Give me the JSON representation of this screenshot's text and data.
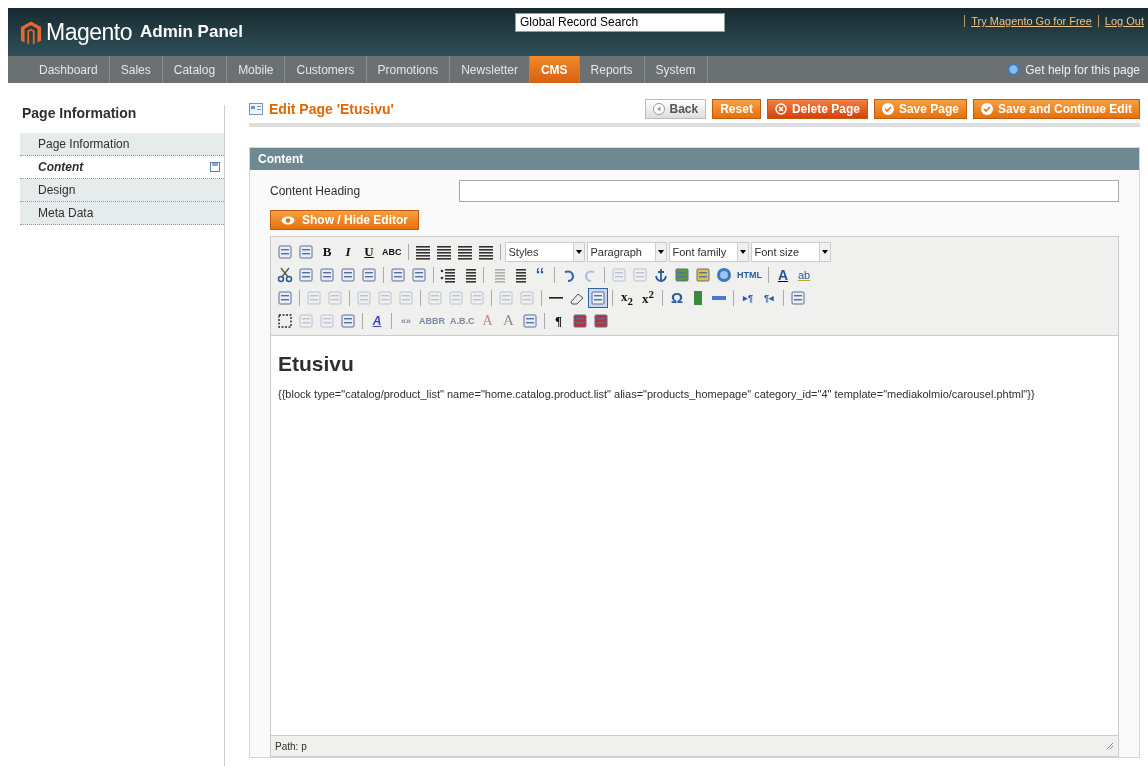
{
  "header": {
    "logo": "Magento",
    "logo_suffix": "Admin Panel",
    "search": {
      "value": "Global Record Search"
    },
    "links": [
      "Try Magento Go for Free",
      "Log Out"
    ]
  },
  "nav": {
    "items": [
      {
        "label": "Dashboard",
        "selected": false
      },
      {
        "label": "Sales",
        "selected": false
      },
      {
        "label": "Catalog",
        "selected": false
      },
      {
        "label": "Mobile",
        "selected": false
      },
      {
        "label": "Customers",
        "selected": false
      },
      {
        "label": "Promotions",
        "selected": false
      },
      {
        "label": "Newsletter",
        "selected": false
      },
      {
        "label": "CMS",
        "selected": true
      },
      {
        "label": "Reports",
        "selected": false
      },
      {
        "label": "System",
        "selected": false
      }
    ],
    "help": "Get help for this page"
  },
  "sidebar": {
    "title": "Page Information",
    "items": [
      {
        "label": "Page Information",
        "selected": false,
        "changed": false
      },
      {
        "label": "Content",
        "selected": true,
        "changed": true
      },
      {
        "label": "Design",
        "selected": false,
        "changed": false
      },
      {
        "label": "Meta Data",
        "selected": false,
        "changed": false
      }
    ]
  },
  "page": {
    "title": "Edit Page 'Etusivu'",
    "buttons": [
      {
        "label": "Back",
        "kind": "back"
      },
      {
        "label": "Reset",
        "kind": "plain"
      },
      {
        "label": "Delete Page",
        "kind": "delete"
      },
      {
        "label": "Save Page",
        "kind": "save"
      },
      {
        "label": "Save and Continue Edit",
        "kind": "save"
      }
    ]
  },
  "section": {
    "title": "Content",
    "heading_label": "Content Heading",
    "toggle_button": "Show / Hide Editor"
  },
  "toolbar": [
    [
      {
        "kind": "icon",
        "disabled": false
      },
      {
        "kind": "icon",
        "disabled": false
      },
      {
        "kind": "glyph",
        "label": "B",
        "disabled": false
      },
      {
        "kind": "glyph",
        "label": "I",
        "disabled": false
      },
      {
        "kind": "glyph",
        "label": "U",
        "disabled": false
      },
      {
        "kind": "glyph",
        "label": "ABC",
        "disabled": false
      },
      {
        "kind": "sep"
      },
      {
        "kind": "icon",
        "disabled": false
      },
      {
        "kind": "icon",
        "disabled": false
      },
      {
        "kind": "icon",
        "disabled": false
      },
      {
        "kind": "icon",
        "disabled": false
      },
      {
        "kind": "sep"
      },
      {
        "kind": "select",
        "label": "Styles"
      },
      {
        "kind": "select",
        "label": "Paragraph"
      },
      {
        "kind": "select",
        "label": "Font family"
      },
      {
        "kind": "select",
        "label": "Font size"
      }
    ],
    [
      {
        "kind": "icon",
        "disabled": false
      },
      {
        "kind": "icon",
        "disabled": false
      },
      {
        "kind": "icon",
        "disabled": false
      },
      {
        "kind": "icon",
        "disabled": false
      },
      {
        "kind": "icon",
        "disabled": false
      },
      {
        "kind": "sep"
      },
      {
        "kind": "icon",
        "disabled": false
      },
      {
        "kind": "icon",
        "disabled": false
      },
      {
        "kind": "sep"
      },
      {
        "kind": "icon",
        "disabled": false
      },
      {
        "kind": "icon",
        "disabled": false
      },
      {
        "kind": "sep"
      },
      {
        "kind": "icon",
        "disabled": true
      },
      {
        "kind": "icon",
        "disabled": false
      },
      {
        "kind": "glyph",
        "label": "‘‘",
        "disabled": false
      },
      {
        "kind": "sep"
      },
      {
        "kind": "icon",
        "disabled": false
      },
      {
        "kind": "icon",
        "disabled": true
      },
      {
        "kind": "sep"
      },
      {
        "kind": "icon",
        "disabled": true
      },
      {
        "kind": "icon",
        "disabled": true
      },
      {
        "kind": "icon",
        "disabled": false
      },
      {
        "kind": "icon",
        "disabled": false
      },
      {
        "kind": "icon",
        "disabled": false
      },
      {
        "kind": "icon",
        "disabled": false
      },
      {
        "kind": "glyph",
        "label": "HTML",
        "disabled": false
      },
      {
        "kind": "sep"
      },
      {
        "kind": "glyph",
        "label": "A",
        "disabled": false
      },
      {
        "kind": "glyph",
        "label": "ab",
        "disabled": false
      }
    ],
    [
      {
        "kind": "icon",
        "disabled": false
      },
      {
        "kind": "sep"
      },
      {
        "kind": "icon",
        "disabled": true
      },
      {
        "kind": "icon",
        "disabled": true
      },
      {
        "kind": "sep"
      },
      {
        "kind": "icon",
        "disabled": true
      },
      {
        "kind": "icon",
        "disabled": true
      },
      {
        "kind": "icon",
        "disabled": true
      },
      {
        "kind": "sep"
      },
      {
        "kind": "icon",
        "disabled": true
      },
      {
        "kind": "icon",
        "disabled": true
      },
      {
        "kind": "icon",
        "disabled": true
      },
      {
        "kind": "sep"
      },
      {
        "kind": "icon",
        "disabled": true
      },
      {
        "kind": "icon",
        "disabled": true
      },
      {
        "kind": "sep"
      },
      {
        "kind": "icon",
        "disabled": false
      },
      {
        "kind": "icon",
        "disabled": false
      },
      {
        "kind": "icon",
        "disabled": false,
        "selected": true
      },
      {
        "kind": "sep"
      },
      {
        "kind": "glyph",
        "label": "x$_{2}$",
        "disabled": false
      },
      {
        "kind": "glyph",
        "label": "x$^{2}$",
        "disabled": false
      },
      {
        "kind": "sep"
      },
      {
        "kind": "glyph",
        "label": "Ω",
        "disabled": false
      },
      {
        "kind": "icon",
        "disabled": false
      },
      {
        "kind": "icon",
        "disabled": false
      },
      {
        "kind": "sep"
      },
      {
        "kind": "glyph",
        "label": "▸¶",
        "disabled": false
      },
      {
        "kind": "glyph",
        "label": "¶◂",
        "disabled": false
      },
      {
        "kind": "sep"
      },
      {
        "kind": "icon",
        "disabled": false
      }
    ],
    [
      {
        "kind": "icon",
        "disabled": false
      },
      {
        "kind": "icon",
        "disabled": true
      },
      {
        "kind": "icon",
        "disabled": true
      },
      {
        "kind": "icon",
        "disabled": false
      },
      {
        "kind": "sep"
      },
      {
        "kind": "glyph",
        "label": "A",
        "disabled": false
      },
      {
        "kind": "sep"
      },
      {
        "kind": "glyph",
        "label": "«»",
        "disabled": true
      },
      {
        "kind": "glyph",
        "label": "ABBR",
        "disabled": true
      },
      {
        "kind": "glyph",
        "label": "A.B.C",
        "disabled": true
      },
      {
        "kind": "glyph",
        "label": "A",
        "disabled": true
      },
      {
        "kind": "glyph",
        "label": "A",
        "disabled": true
      },
      {
        "kind": "icon",
        "disabled": false
      },
      {
        "kind": "sep"
      },
      {
        "kind": "glyph",
        "label": "¶",
        "disabled": false
      },
      {
        "kind": "icon",
        "disabled": false
      },
      {
        "kind": "icon",
        "disabled": false
      }
    ]
  ],
  "editor": {
    "heading": "Etusivu",
    "body": "{{block type=\"catalog/product_list\" name=\"home.catalog.product.list\" alias=\"products_homepage\" category_id=\"4\" template=\"mediakolmio/carousel.phtml\"}}",
    "path": "Path: p"
  }
}
